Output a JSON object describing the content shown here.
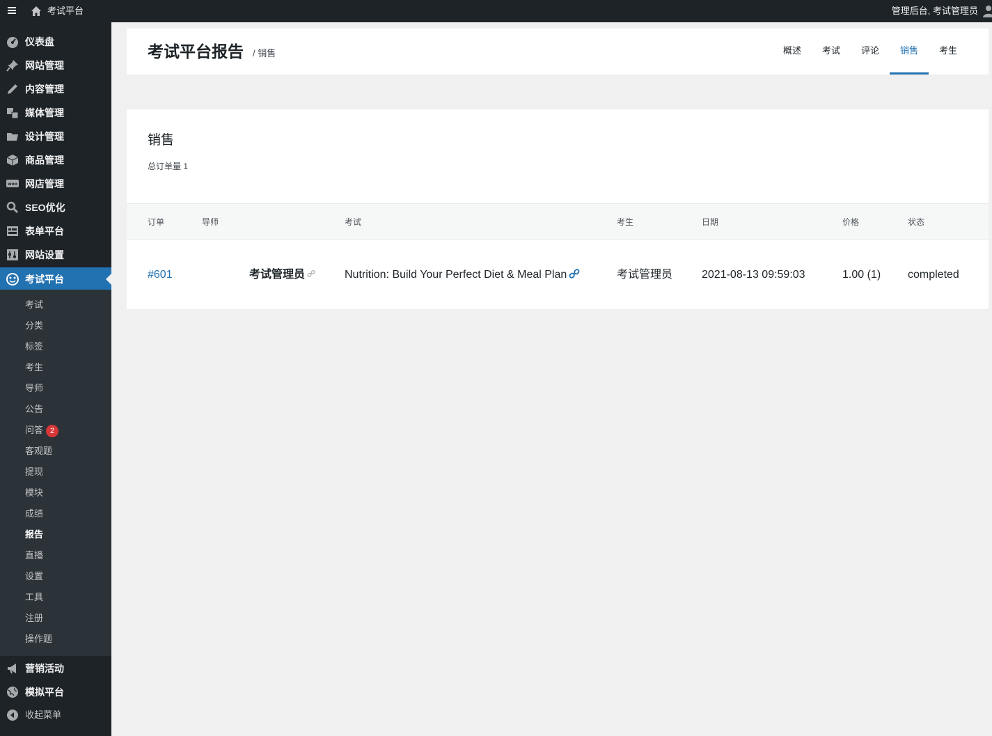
{
  "adminbar": {
    "site_name": "考试平台",
    "account_text": "管理后台, 考试管理员"
  },
  "sidebar": {
    "items": [
      {
        "label": "仪表盘",
        "icon": "dashboard-icon"
      },
      {
        "label": "网站管理",
        "icon": "pin-icon"
      },
      {
        "label": "内容管理",
        "icon": "pencil-icon"
      },
      {
        "label": "媒体管理",
        "icon": "media-icon"
      },
      {
        "label": "设计管理",
        "icon": "folder-icon"
      },
      {
        "label": "商品管理",
        "icon": "box-icon"
      },
      {
        "label": "网店管理",
        "icon": "woo-icon"
      },
      {
        "label": "SEO优化",
        "icon": "search-icon"
      },
      {
        "label": "表单平台",
        "icon": "form-icon"
      },
      {
        "label": "网站设置",
        "icon": "settings-icon"
      },
      {
        "label": "考试平台",
        "icon": "exam-icon"
      }
    ],
    "submenu": [
      {
        "label": "考试"
      },
      {
        "label": "分类"
      },
      {
        "label": "标签"
      },
      {
        "label": "考生"
      },
      {
        "label": "导师"
      },
      {
        "label": "公告"
      },
      {
        "label": "问答",
        "badge": "2"
      },
      {
        "label": "客观题"
      },
      {
        "label": "提现"
      },
      {
        "label": "模块"
      },
      {
        "label": "成绩"
      },
      {
        "label": "报告"
      },
      {
        "label": "直播"
      },
      {
        "label": "设置"
      },
      {
        "label": "工具"
      },
      {
        "label": "注册"
      },
      {
        "label": "操作题"
      }
    ],
    "bottom_items": [
      {
        "label": "营销活动",
        "icon": "megaphone-icon"
      },
      {
        "label": "模拟平台",
        "icon": "globe-icon"
      }
    ],
    "collapse_label": "收起菜单"
  },
  "header": {
    "title": "考试平台报告",
    "crumb": "/ 销售",
    "tabs": [
      {
        "label": "概述"
      },
      {
        "label": "考试"
      },
      {
        "label": "评论"
      },
      {
        "label": "销售"
      },
      {
        "label": "考生"
      }
    ]
  },
  "sales": {
    "title": "销售",
    "total_label": "总订单量 1",
    "columns": [
      "订单",
      "导师",
      "考试",
      "考生",
      "日期",
      "价格",
      "状态"
    ],
    "rows": [
      {
        "order": "#601",
        "instructor": "考试管理员",
        "exam": "Nutrition: Build Your Perfect Diet & Meal Plan",
        "student": "考试管理员",
        "date": "2021-08-13 09:59:03",
        "price": "1.00 (1)",
        "status": "completed"
      }
    ]
  },
  "colors": {
    "accent": "#2271b1",
    "sidebar_bg": "#1d2327",
    "submenu_bg": "#2c3338",
    "badge": "#d63638"
  }
}
